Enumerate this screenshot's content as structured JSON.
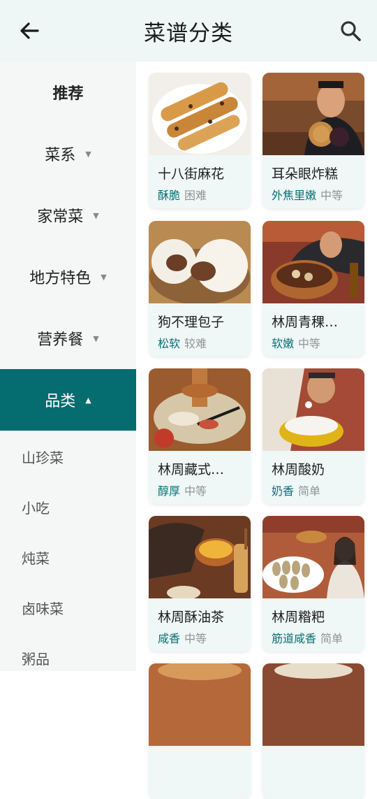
{
  "header": {
    "title": "菜谱分类"
  },
  "sidebar": {
    "categories": [
      {
        "label": "推荐",
        "caret": "",
        "active": false
      },
      {
        "label": "菜系",
        "caret": "▼",
        "active": false
      },
      {
        "label": "家常菜",
        "caret": "▼",
        "active": false
      },
      {
        "label": "地方特色",
        "caret": "▼",
        "active": false
      },
      {
        "label": "营养餐",
        "caret": "▼",
        "active": false
      },
      {
        "label": "品类",
        "caret": "▲",
        "active": true
      }
    ],
    "subitems": [
      "山珍菜",
      "小吃",
      "炖菜",
      "卤味菜",
      "粥品"
    ]
  },
  "recipes": [
    {
      "name": "十八街麻花",
      "tag": "酥脆",
      "difficulty": "困难"
    },
    {
      "name": "耳朵眼炸糕",
      "tag": "外焦里嫩",
      "difficulty": "中等"
    },
    {
      "name": "狗不理包子",
      "tag": "松软",
      "difficulty": "较难"
    },
    {
      "name": "林周青稞…",
      "tag": "软嫩",
      "difficulty": "中等"
    },
    {
      "name": "林周藏式…",
      "tag": "醇厚",
      "difficulty": "中等"
    },
    {
      "name": "林周酸奶",
      "tag": "奶香",
      "difficulty": "简单"
    },
    {
      "name": "林周酥油茶",
      "tag": "咸香",
      "difficulty": "中等"
    },
    {
      "name": "林周糌粑",
      "tag": "筋道咸香",
      "difficulty": "简单"
    }
  ],
  "colors": {
    "accent": "#056c6f",
    "header_bg": "#eef6f6",
    "sidebar_bg": "#f5f6f6"
  }
}
